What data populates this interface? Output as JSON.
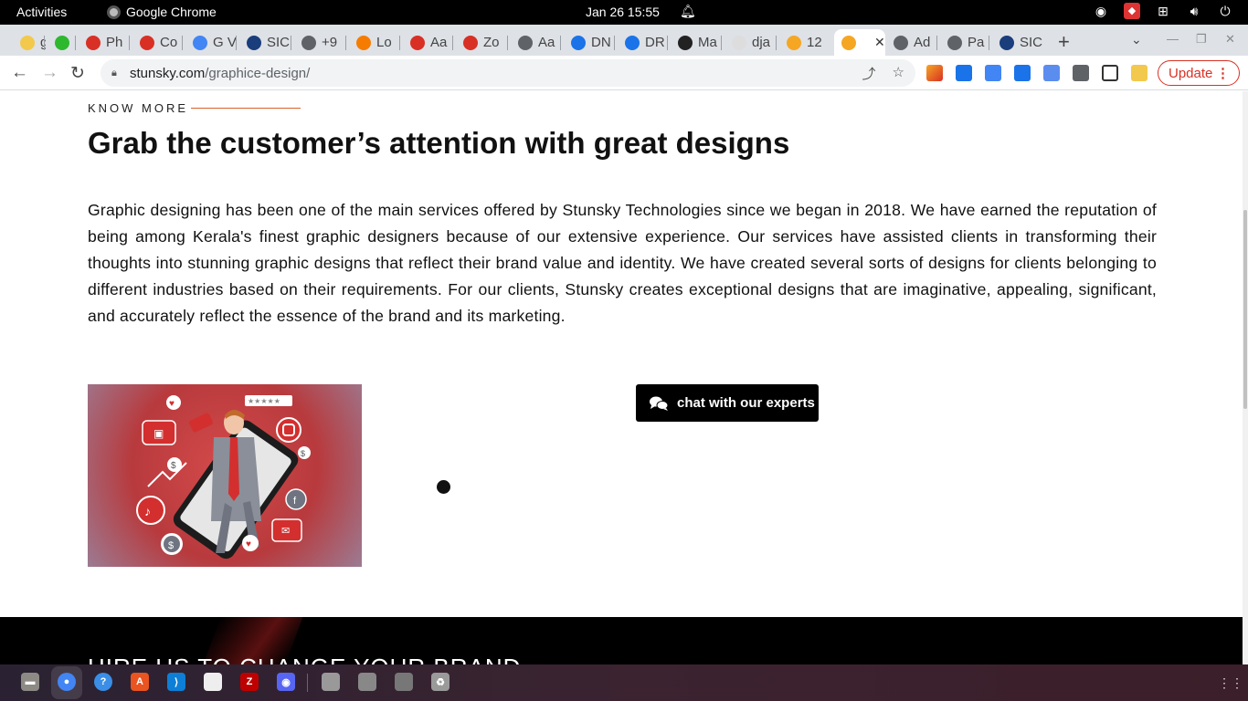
{
  "topbar": {
    "activities": "Activities",
    "app_name": "Google Chrome",
    "clock": "Jan 26  15:55"
  },
  "tabs": [
    {
      "label": "g",
      "color": "#f2c94c"
    },
    {
      "label": "",
      "color": "#2eb82e"
    },
    {
      "label": "Ph",
      "color": "#d93025"
    },
    {
      "label": "Co",
      "color": "#d93025"
    },
    {
      "label": "G V",
      "color": "#4285f4"
    },
    {
      "label": "SIC",
      "color": "#1a3d7c"
    },
    {
      "label": "+9",
      "color": "#5f6368"
    },
    {
      "label": "Lo",
      "color": "#f57c00"
    },
    {
      "label": "Aa",
      "color": "#d93025"
    },
    {
      "label": "Zo",
      "color": "#d93025"
    },
    {
      "label": "Aa",
      "color": "#5f6368"
    },
    {
      "label": "DN",
      "color": "#1a73e8"
    },
    {
      "label": "DR",
      "color": "#1a73e8"
    },
    {
      "label": "Ma",
      "color": "#222222"
    },
    {
      "label": "dja",
      "color": "#dddddd"
    },
    {
      "label": "12",
      "color": "#f5a623"
    },
    {
      "label": "",
      "color": "#f5a623"
    },
    {
      "label": "Ad",
      "color": "#5f6368"
    },
    {
      "label": "Pa",
      "color": "#5f6368"
    },
    {
      "label": "SIC",
      "color": "#1a3d7c"
    }
  ],
  "toolbar": {
    "url_host": "stunsky.com",
    "url_path": "/graphice-design/",
    "update_label": "Update"
  },
  "page": {
    "eyebrow": "KNOW MORE",
    "heading": "Grab the customer’s attention with great designs",
    "body": "Graphic designing has been one of the main services offered by Stunsky Technologies since we began in 2018. We have earned the reputation of being among Kerala's finest graphic designers because of our extensive experience. Our services have assisted clients in transforming their thoughts into stunning graphic designs that reflect their brand value and identity. We have created several sorts of designs for clients belonging to different industries based on their requirements. For our clients, Stunsky creates exceptional designs that are imaginative, appealing, significant, and accurately reflect the essence of the brand and its marketing.",
    "chat_button": "chat with our experts",
    "footer_heading": "HIRE US TO CHANGE YOUR BRAND",
    "accent_color": "#d9602a"
  },
  "dock": {
    "items": [
      "files-icon",
      "chrome-icon",
      "help-icon",
      "software-icon",
      "vscode-icon",
      "text-editor-icon",
      "filezilla-icon",
      "discord-icon",
      "disk-icon",
      "archive-icon",
      "drive-icon",
      "trash-icon"
    ]
  }
}
